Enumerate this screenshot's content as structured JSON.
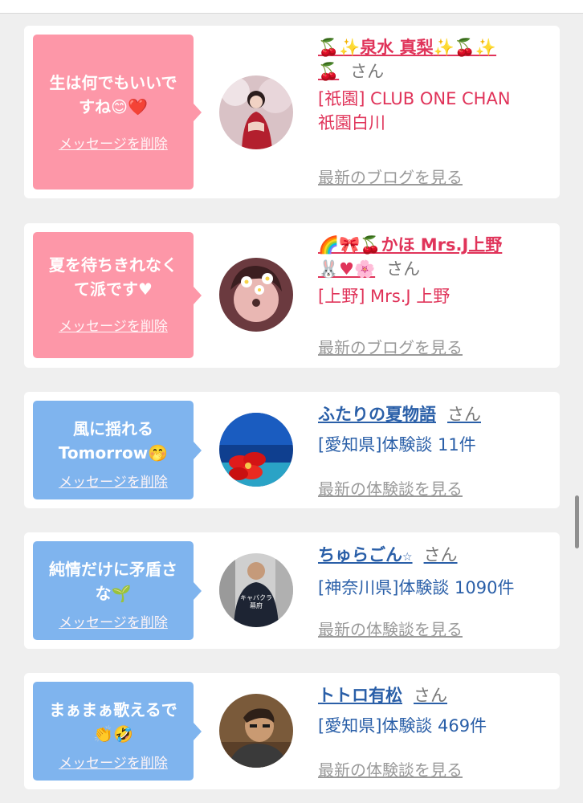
{
  "cards": [
    {
      "theme": "pink",
      "message": "生は何でもいいで\nすね😊❤️",
      "delete_label": "メッセージを削除",
      "name_prefix": "🍒✨",
      "name": "泉水 真梨",
      "name_suffix": "✨🍒✨",
      "name_line2": "🍒",
      "honorific": "さん",
      "desc_lines": [
        "[祇園] CLUB ONE CHAN",
        "祇園白川"
      ],
      "more_label": "最新のブログを見る",
      "avatar_icon": "woman-in-red-dress-photo"
    },
    {
      "theme": "pink",
      "message": "夏を待ちきれなく\nて派です♥",
      "delete_label": "メッセージを削除",
      "name_prefix": "🌈🎀🍒",
      "name": "かほ Mrs.J上野",
      "name_suffix": "",
      "name_line2": "🐰♥🌸",
      "honorific": "さん",
      "desc_lines": [
        "[上野] Mrs.J 上野"
      ],
      "more_label": "最新のブログを見る",
      "avatar_icon": "girl-with-flower-filter-photo"
    },
    {
      "theme": "blue",
      "message": "風に揺れる\nTomorrow🤭",
      "delete_label": "メッセージを削除",
      "name_prefix": "",
      "name": "ふたりの夏物語",
      "name_suffix": "",
      "name_line2": "",
      "honorific": "さん",
      "desc_lines": [
        "[愛知県]体験談 11件"
      ],
      "more_label": "最新の体験談を見る",
      "avatar_icon": "hibiscus-ocean-photo"
    },
    {
      "theme": "blue",
      "message": "純情だけに矛盾さ\nな🌱",
      "delete_label": "メッセージを削除",
      "name_prefix": "",
      "name": "ちゅらごん",
      "name_suffix": "☆",
      "name_line2": "",
      "honorific": "さん",
      "desc_lines": [
        "[神奈川県]体験談 1090件"
      ],
      "more_label": "最新の体験談を見る",
      "avatar_icon": "man-in-jacket-photo",
      "avatar_caption": "キャバクラ\n幕府"
    },
    {
      "theme": "blue",
      "message": "まぁまぁ歌えるで\n👏🤣",
      "delete_label": "メッセージを削除",
      "name_prefix": "",
      "name": "トトロ有松",
      "name_suffix": "",
      "name_line2": "",
      "honorific": "さん",
      "desc_lines": [
        "[愛知県]体験談 469件"
      ],
      "more_label": "最新の体験談を見る",
      "avatar_icon": "man-lying-down-photo"
    }
  ],
  "colors": {
    "pink_bubble": "#fd97a8",
    "blue_bubble": "#7fb4ee",
    "pink_text": "#e0345a",
    "blue_text": "#2a5fa8",
    "muted": "#9a9a9a"
  }
}
